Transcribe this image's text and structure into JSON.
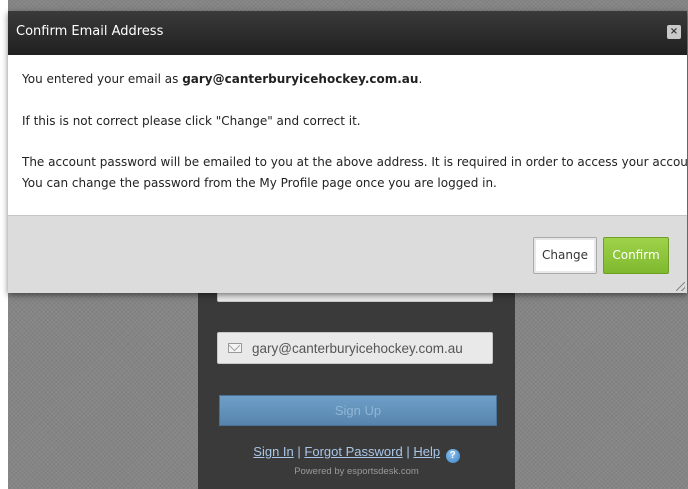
{
  "dialog": {
    "title": "Confirm Email Address",
    "close_label": "×",
    "line1_prefix": "You entered your email as ",
    "email": "gary@canterburyicehockey.com.au",
    "line1_suffix": ".",
    "line2": "If this is not correct please click \"Change\" and correct it.",
    "line3": "The account password will be emailed to you at the above address. It is required in order to access your account.",
    "line4": "You can change the password from the My Profile page once you are logged in.",
    "change_label": "Change",
    "confirm_label": "Confirm"
  },
  "signup": {
    "email_value": "gary@canterburyicehockey.com.au",
    "signup_label": "Sign Up",
    "links": {
      "sign_in": "Sign In",
      "separator": "|",
      "forgot_password": "Forgot Password",
      "help": "Help",
      "help_icon_glyph": "?"
    },
    "powered_by": "Powered by esportsdesk.com"
  },
  "colors": {
    "confirm_green": "#8bc53f",
    "titlebar_dark": "#2a2a2a",
    "signup_blue": "#6392bb",
    "link_blue": "#a8c6e8"
  },
  "icons": {
    "close": "close-icon",
    "email_field": "envelope-icon",
    "help": "help-icon",
    "resize": "resize-grip-icon"
  }
}
